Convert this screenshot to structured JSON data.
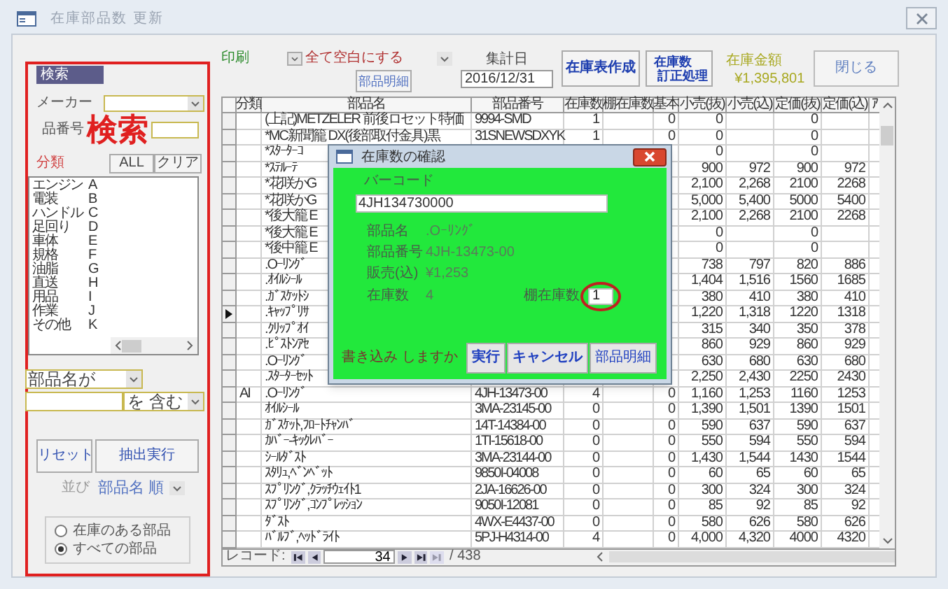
{
  "window": {
    "title": "在庫部品数 更新"
  },
  "search_panel": {
    "header": "検索",
    "maker_label": "メーカー",
    "part_no_label": "品番号",
    "overlay_label": "検索",
    "category_label": "分類",
    "all_button": "ALL",
    "clear_button": "クリア",
    "categories": [
      {
        "name": "エンジン",
        "code": "A"
      },
      {
        "name": "電装",
        "code": "B"
      },
      {
        "name": "ハンドル",
        "code": "C"
      },
      {
        "name": "足回り",
        "code": "D"
      },
      {
        "name": "車体",
        "code": "E"
      },
      {
        "name": "規格",
        "code": "F"
      },
      {
        "name": "油脂",
        "code": "G"
      },
      {
        "name": "直送",
        "code": "H"
      },
      {
        "name": "用品",
        "code": "I"
      },
      {
        "name": "作業",
        "code": "J"
      },
      {
        "name": "その他",
        "code": "K"
      }
    ],
    "field_select": "部品名が",
    "match_select": "を 含む",
    "reset_button": "リセット",
    "extract_button": "抽出実行",
    "sort_label": "並び",
    "sort_select": "部品名 順",
    "stock_filter": [
      {
        "label": "在庫のある部品",
        "selected": false
      },
      {
        "label": "すべての部品",
        "selected": true
      }
    ]
  },
  "toolbar": {
    "print_label": "印刷",
    "print_select": "全て空白にする",
    "part_detail_button": "部品明細",
    "date_label": "集計日",
    "date_value": "2016/12/31",
    "inventory_report_button": "在庫表作成",
    "stock_correction_button": [
      "在庫数",
      "訂正処理"
    ],
    "total_label": "在庫金額",
    "total_value": "¥1,395,801",
    "close_button": "閉じる"
  },
  "table": {
    "columns": [
      "分類",
      "部品名",
      "部品番号",
      "在庫数",
      "棚在庫数",
      "基本",
      "小売(抜)",
      "小売(込)",
      "定価(抜)",
      "定価(込)",
      "ｱ"
    ],
    "rows": [
      {
        "name": "(上記)METZELER 前後ロセット特価",
        "part_no": "9994-SMD",
        "stock": "1",
        "base": "0",
        "retail_ex": "0",
        "list_ex": "0",
        "selected": false
      },
      {
        "name": "*MC新聞籠 DX(後部取付金具)黒",
        "part_no": "31SNEWSDXYK",
        "stock": "1",
        "base": "0",
        "retail_ex": "0",
        "list_ex": "0",
        "selected": false
      },
      {
        "name": "*ｽﾀｰﾀｰｺ",
        "retail_ex": "0",
        "list_ex": "0",
        "selected": false
      },
      {
        "name": "*ｽﾃﾙｰﾃ",
        "retail_ex": "900",
        "retail_in": "972",
        "list_ex": "900",
        "list_in": "972",
        "selected": false
      },
      {
        "name": "*花咲かG",
        "retail_ex": "2,100",
        "retail_in": "2,268",
        "list_ex": "2100",
        "list_in": "2268",
        "selected": false
      },
      {
        "name": "*花咲かG",
        "retail_ex": "5,000",
        "retail_in": "5,400",
        "list_ex": "5000",
        "list_in": "5400",
        "selected": false
      },
      {
        "name": "*後大籠 E",
        "retail_ex": "2,100",
        "retail_in": "2,268",
        "list_ex": "2100",
        "list_in": "2268",
        "selected": false
      },
      {
        "name": "*後大籠 E",
        "retail_ex": "0",
        "list_ex": "0",
        "selected": false
      },
      {
        "name": "*後中籠 E",
        "retail_ex": "0",
        "list_ex": "0",
        "selected": false
      },
      {
        "name": ".Oｰﾘﾝｸﾞ",
        "retail_ex": "738",
        "retail_in": "797",
        "list_ex": "820",
        "list_in": "886",
        "selected": false
      },
      {
        "name": ".ｵｲﾙｼｰﾙ",
        "retail_ex": "1,404",
        "retail_in": "1,516",
        "list_ex": "1560",
        "list_in": "1685",
        "selected": false
      },
      {
        "name": ".ｶﾞｽｹｯﾄｼ",
        "retail_ex": "380",
        "retail_in": "410",
        "list_ex": "380",
        "list_in": "410",
        "selected": false
      },
      {
        "name": ".ｷｬｯﾌﾟﾘｻ",
        "retail_ex": "1,220",
        "retail_in": "1,318",
        "list_ex": "1220",
        "list_in": "1318",
        "selected": true
      },
      {
        "name": ".ｸﾘｯﾌﾟｵｲ",
        "retail_ex": "315",
        "retail_in": "340",
        "list_ex": "350",
        "list_in": "378",
        "selected": false
      },
      {
        "name": ".ﾋﾟｽﾄﾝｱｾ",
        "retail_ex": "860",
        "retail_in": "929",
        "list_ex": "860",
        "list_in": "929",
        "selected": false
      },
      {
        "name": ".Oｰﾘﾝｸﾞ",
        "retail_ex": "630",
        "retail_in": "680",
        "list_ex": "630",
        "list_in": "680",
        "selected": false
      },
      {
        "name": ".ｽﾀｰﾀｰｾｯﾄ",
        "retail_ex": "2,250",
        "retail_in": "2,430",
        "list_ex": "2250",
        "list_in": "2430",
        "selected": false
      },
      {
        "category": "AI",
        "name": ".Oｰﾘﾝｸﾞ",
        "part_no": "4JH-13473-00",
        "stock": "4",
        "base": "0",
        "retail_ex": "1,160",
        "retail_in": "1,253",
        "list_ex": "1160",
        "list_in": "1253",
        "selected": false
      },
      {
        "name": "ｵｲﾙｼｰﾙ",
        "part_no": "3MA-23145-00",
        "stock": "0",
        "base": "0",
        "retail_ex": "1,390",
        "retail_in": "1,501",
        "list_ex": "1390",
        "list_in": "1501",
        "selected": false
      },
      {
        "name": "ｶﾞｽｹｯﾄ,ﾌﾛｰﾄﾁｬﾝﾊﾞ",
        "part_no": "14T-14384-00",
        "stock": "0",
        "base": "0",
        "retail_ex": "590",
        "retail_in": "637",
        "list_ex": "590",
        "list_in": "637",
        "selected": false
      },
      {
        "name": "ｶﾊﾞｰ-ｷｯｸﾚﾊﾞｰ",
        "part_no": "1TI-15618-00",
        "stock": "0",
        "base": "0",
        "retail_ex": "550",
        "retail_in": "594",
        "list_ex": "550",
        "list_in": "594",
        "selected": false
      },
      {
        "name": "ｼｰﾙﾀﾞｽﾄ",
        "part_no": "3MA-23144-00",
        "stock": "0",
        "base": "0",
        "retail_ex": "1,430",
        "retail_in": "1,544",
        "list_ex": "1430",
        "list_in": "1544",
        "selected": false
      },
      {
        "name": "ｽﾀﾘｭ,ﾍﾞﾝﾍﾞｯﾄ",
        "part_no": "9850I-04008",
        "stock": "0",
        "base": "0",
        "retail_ex": "60",
        "retail_in": "65",
        "list_ex": "60",
        "list_in": "65",
        "selected": false
      },
      {
        "name": "ｽﾌﾟﾘﾝｸﾞ,ｸﾗｯﾁｳｪｲﾄ1",
        "part_no": "2JA-16626-00",
        "stock": "0",
        "base": "0",
        "retail_ex": "300",
        "retail_in": "324",
        "list_ex": "300",
        "list_in": "324",
        "selected": false
      },
      {
        "name": "ｽﾌﾟﾘﾝｸﾞ,ｺﾝﾌﾟﾚｯｼｮﾝ",
        "part_no": "9050I-12081",
        "stock": "0",
        "base": "0",
        "retail_ex": "85",
        "retail_in": "92",
        "list_ex": "85",
        "list_in": "92",
        "selected": false
      },
      {
        "name": "ﾀﾞｽﾄ",
        "part_no": "4WX-E4437-00",
        "stock": "0",
        "base": "0",
        "retail_ex": "580",
        "retail_in": "626",
        "list_ex": "580",
        "list_in": "626",
        "selected": false
      },
      {
        "name": "ﾊﾞﾙﾌﾞ,ﾍｯﾄﾞﾗｲﾄ",
        "part_no": "5PJ-H4314-00",
        "stock": "4",
        "base": "0",
        "retail_ex": "4,000",
        "retail_in": "4,320",
        "list_ex": "4000",
        "list_in": "4320",
        "selected": false
      }
    ]
  },
  "navigator": {
    "label": "レコード:",
    "current": "34",
    "total": "/ 438"
  },
  "dialog": {
    "title": "在庫数の確認",
    "barcode_label": "バーコード",
    "barcode_value": "4JH134730000",
    "fields": [
      {
        "label": "部品名",
        "value": ".Oｰﾘﾝｸﾞ"
      },
      {
        "label": "部品番号",
        "value": "4JH-13473-00"
      },
      {
        "label": "販売(込)",
        "value": "¥1,253"
      }
    ],
    "stock_label": "在庫数",
    "stock_value": "4",
    "shelf_label": "棚在庫数",
    "shelf_value": "1",
    "prompt": "書き込み しますか",
    "buttons": [
      {
        "label": "実行",
        "bold": true
      },
      {
        "label": "キャンセル",
        "bold": true
      },
      {
        "label": "部品明細",
        "bold": false
      }
    ]
  }
}
